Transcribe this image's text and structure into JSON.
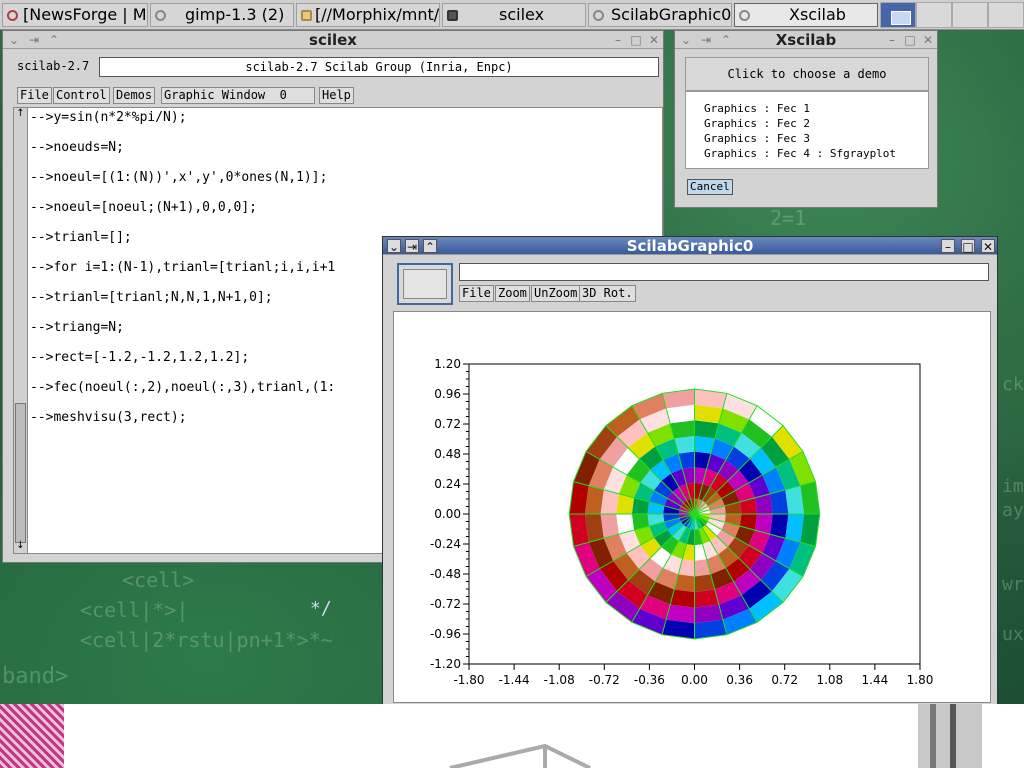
{
  "taskbar": {
    "tasks": [
      {
        "label": "[NewsForge | Mi",
        "active": false
      },
      {
        "label": "gimp-1.3 (2)",
        "active": false
      },
      {
        "label": "[//Morphix/mnt/h",
        "active": false
      },
      {
        "label": "scilex",
        "active": false
      },
      {
        "label": "ScilabGraphic0",
        "active": false
      },
      {
        "label": "Xscilab",
        "active": false
      }
    ]
  },
  "desktop": {
    "bg_lines": [
      "<cell>",
      "<cell|*>|",
      "<cell|2*rstu|pn+1*>*~",
      "band>",
      "2=1",
      "ck",
      "im",
      "aye",
      "wr",
      "uxi",
      "*/"
    ]
  },
  "scilex": {
    "title": "scilex",
    "version": "scilab-2.7",
    "banner": "scilab-2.7 Scilab Group (Inria, Enpc)",
    "menu": [
      {
        "label": "File"
      },
      {
        "label": "Control"
      },
      {
        "label": "Demos"
      },
      {
        "label": "Graphic Window  0"
      },
      {
        "label": "Help"
      }
    ],
    "console": [
      "-->y=sin(n*2*%pi/N);",
      "-->noeuds=N;",
      "-->noeul=[(1:(N))',x',y',0*ones(N,1)];",
      "-->noeul=[noeul;(N+1),0,0,0];",
      "-->trianl=[];",
      "-->for i=1:(N-1),trianl=[trianl;i,i,i+1",
      "-->trianl=[trianl;N,N,1,N+1,0];",
      "-->triang=N;",
      "-->rect=[-1.2,-1.2,1.2,1.2];",
      "-->fec(noeul(:,2),noeul(:,3),trianl,(1:",
      "-->meshvisu(3,rect);"
    ]
  },
  "xscilab": {
    "title": "Xscilab",
    "header": "Click to choose a demo",
    "demos": [
      "Graphics : Fec 1",
      "Graphics : Fec 2",
      "Graphics : Fec 3",
      "Graphics : Fec 4 : Sfgrayplot"
    ],
    "cancel_label": "Cancel"
  },
  "graphic": {
    "title": "ScilabGraphic0",
    "menu": [
      {
        "label": "File"
      },
      {
        "label": "Zoom"
      },
      {
        "label": "UnZoom"
      },
      {
        "label": "3D Rot."
      }
    ],
    "entry_value": ""
  },
  "chart_data": {
    "type": "heatmap",
    "title": "",
    "xlabel": "",
    "ylabel": "",
    "xlim": [
      -1.8,
      1.8
    ],
    "ylim": [
      -1.2,
      1.2
    ],
    "x_ticks": [
      "-1.80",
      "-1.44",
      "-1.08",
      "-0.72",
      "-0.36",
      "0.00",
      "0.36",
      "0.72",
      "1.08",
      "1.44",
      "1.80"
    ],
    "y_ticks": [
      "1.20",
      "0.96",
      "0.72",
      "0.48",
      "0.24",
      "0.00",
      "-0.24",
      "-0.48",
      "-0.72",
      "-0.96",
      "-1.20"
    ],
    "shape": "disc",
    "center": [
      0,
      0
    ],
    "radius": 1.0,
    "sectors": 24,
    "rings": 8,
    "mesh_color": "#22dd22"
  }
}
